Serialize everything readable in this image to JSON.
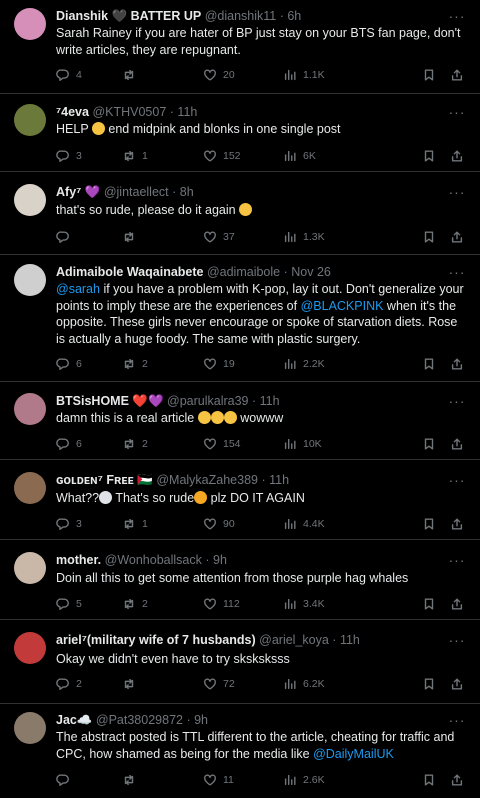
{
  "tweets": [
    {
      "name": "Dianshik 🖤 BATTER UP",
      "handle": "@dianshik11",
      "time": "6h",
      "text": "Sarah Rainey if you are hater of BP just stay on your BTS fan page, don't write articles, they are repugnant.",
      "replies": "4",
      "retweets": "",
      "likes": "20",
      "views": "1.1K",
      "avatar_color": "#d58fb8"
    },
    {
      "name": "⁷4eva",
      "handle": "@KTHV0507",
      "time": "11h",
      "text_before": "HELP",
      "text_after": "end midpink and blonks in one single post",
      "replies": "3",
      "retweets": "1",
      "likes": "152",
      "views": "6K",
      "avatar_color": "#6b7a3a"
    },
    {
      "name": "Afy⁷ 💜",
      "handle": "@jintaellect",
      "time": "8h",
      "text": "that's so rude, please do it again",
      "replies": "",
      "retweets": "",
      "likes": "37",
      "views": "1.3K",
      "avatar_color": "#d9d2c9"
    },
    {
      "name": "Adimaibole Waqainabete",
      "handle": "@adimaibole",
      "time": "Nov 26",
      "mention1": "@sarah",
      "text_a": " if you have a problem with K-pop, lay it out. Don't generalize your points to imply these are the experiences of ",
      "mention2": "@BLACKPINK",
      "text_b": " when it's the opposite. These girls never encourage or spoke of starvation diets. Rose is actually a huge foody. The same with plastic surgery.",
      "replies": "6",
      "retweets": "2",
      "likes": "19",
      "views": "2.2K",
      "avatar_color": "#cfcfcf"
    },
    {
      "name": "BTSisHOME ❤️💜",
      "handle": "@parulkalra39",
      "time": "11h",
      "text_before": "damn this is a real article",
      "text_after": "wowww",
      "replies": "6",
      "retweets": "2",
      "likes": "154",
      "views": "10K",
      "avatar_color": "#b07a8a"
    },
    {
      "name": "ɢᴏʟᴅᴇɴ⁷ Fʀᴇᴇ 🇵🇸",
      "handle": "@MalykaZahe389",
      "time": "11h",
      "text_a": "What??",
      "text_b": " That's so rude",
      "text_c": " plz DO IT AGAIN",
      "replies": "3",
      "retweets": "1",
      "likes": "90",
      "views": "4.4K",
      "avatar_color": "#8a6b52"
    },
    {
      "name": "mother.",
      "handle": "@Wonhoballsack",
      "time": "9h",
      "text": "Doin all this to get some attention from those purple hag whales",
      "replies": "5",
      "retweets": "2",
      "likes": "112",
      "views": "3.4K",
      "avatar_color": "#c9b7a8"
    },
    {
      "name": "ariel⁷(military wife of 7 husbands)",
      "handle": "@ariel_koya",
      "time": "11h",
      "text": "Okay we didn't even have to try sksksksss",
      "replies": "2",
      "retweets": "",
      "likes": "72",
      "views": "6.2K",
      "avatar_color": "#c23a3a"
    },
    {
      "name": "Jac☁️",
      "handle": "@Pat38029872",
      "time": "9h",
      "text_a": "The abstract posted is TTL different to the article, cheating for traffic and CPC, how shamed as being for the media like ",
      "mention": "@DailyMailUK",
      "replies": "",
      "retweets": "",
      "likes": "11",
      "views": "2.6K",
      "avatar_color": "#8a7a6a"
    }
  ],
  "more_glyph": "···"
}
